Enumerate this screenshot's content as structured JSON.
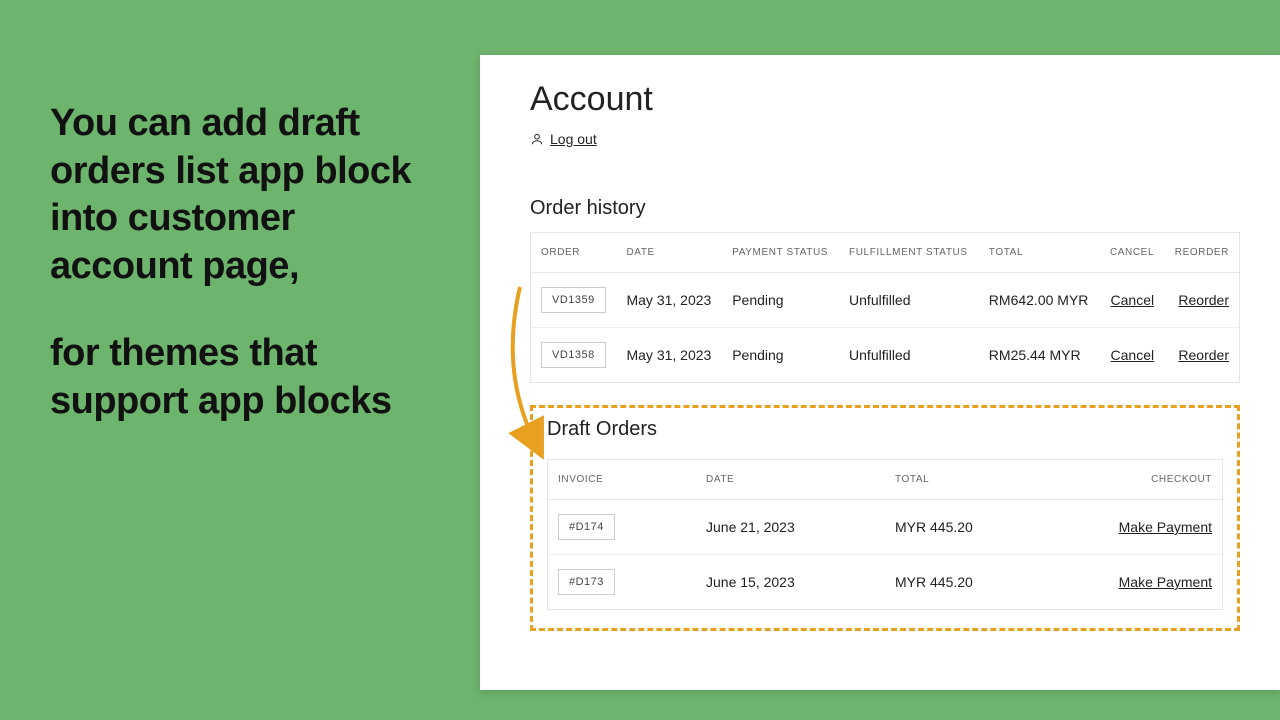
{
  "promo": {
    "line1": "You can add draft orders list app block into customer account page,",
    "line2": "for themes that support app blocks"
  },
  "account": {
    "title": "Account",
    "logout": "Log out"
  },
  "order_history": {
    "title": "Order history",
    "columns": {
      "order": "ORDER",
      "date": "DATE",
      "payment": "PAYMENT STATUS",
      "fulfillment": "FULFILLMENT STATUS",
      "total": "TOTAL",
      "cancel": "CANCEL",
      "reorder": "REORDER"
    },
    "rows": [
      {
        "order": "VD1359",
        "date": "May 31, 2023",
        "payment": "Pending",
        "fulfillment": "Unfulfilled",
        "total": "RM642.00 MYR",
        "cancel": "Cancel",
        "reorder": "Reorder"
      },
      {
        "order": "VD1358",
        "date": "May 31, 2023",
        "payment": "Pending",
        "fulfillment": "Unfulfilled",
        "total": "RM25.44 MYR",
        "cancel": "Cancel",
        "reorder": "Reorder"
      }
    ]
  },
  "draft_orders": {
    "title": "Draft Orders",
    "columns": {
      "invoice": "INVOICE",
      "date": "DATE",
      "total": "TOTAL",
      "checkout": "CHECKOUT"
    },
    "rows": [
      {
        "invoice": "#D174",
        "date": "June 21, 2023",
        "total": "MYR 445.20",
        "checkout": "Make Payment"
      },
      {
        "invoice": "#D173",
        "date": "June 15, 2023",
        "total": "MYR 445.20",
        "checkout": "Make Payment"
      }
    ]
  }
}
